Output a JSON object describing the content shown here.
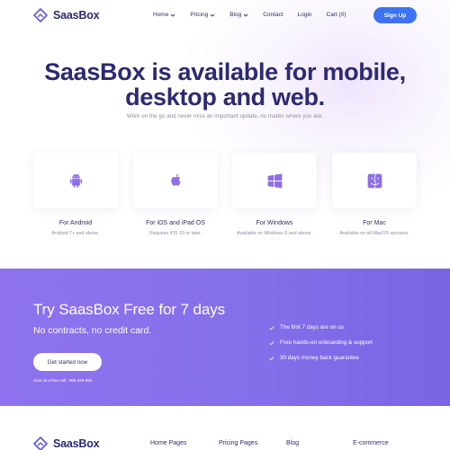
{
  "brand": {
    "name": "SaasBox"
  },
  "nav": {
    "items": [
      {
        "label": "Home",
        "dropdown": true
      },
      {
        "label": "Pricing",
        "dropdown": true
      },
      {
        "label": "Blog",
        "dropdown": true
      },
      {
        "label": "Contact",
        "dropdown": false
      },
      {
        "label": "Login",
        "dropdown": false
      },
      {
        "label": "Cart (0)",
        "dropdown": false
      }
    ],
    "signup_label": "Sign Up"
  },
  "hero": {
    "title_line1": "SaasBox is available for mobile,",
    "title_line2": "desktop and web.",
    "subtitle": "Work on the go and never miss an important update, no matter where you are."
  },
  "platforms": [
    {
      "icon": "android-icon",
      "title": "For Android",
      "desc": "Android 7+ and above."
    },
    {
      "icon": "apple-icon",
      "title": "For iOS and iPad OS",
      "desc": "Requires iOS 10 or later."
    },
    {
      "icon": "windows-icon",
      "title": "For Windows",
      "desc": "Available on Windows 8 and above."
    },
    {
      "icon": "finder-icon",
      "title": "For Mac",
      "desc": "Available on all MacOS versions."
    }
  ],
  "trial": {
    "title": "Try SaasBox Free for 7 days",
    "subtitle": "No contracts, no credit card.",
    "cta_label": "Get started now",
    "call_text": "Give us a free call : 995-265-656",
    "features": [
      "The first 7 days are on us",
      "Free hands-on onboarding & support",
      "30 days money back guarantee"
    ]
  },
  "footer": {
    "columns": [
      "Home Pages",
      "Pricing Pages",
      "Blog",
      "E-commerce"
    ]
  },
  "colors": {
    "primary": "#3d73f0",
    "heading": "#2c2a72",
    "accent_purple": "#8e72ef",
    "icon_purple": "#8f6fe6"
  }
}
